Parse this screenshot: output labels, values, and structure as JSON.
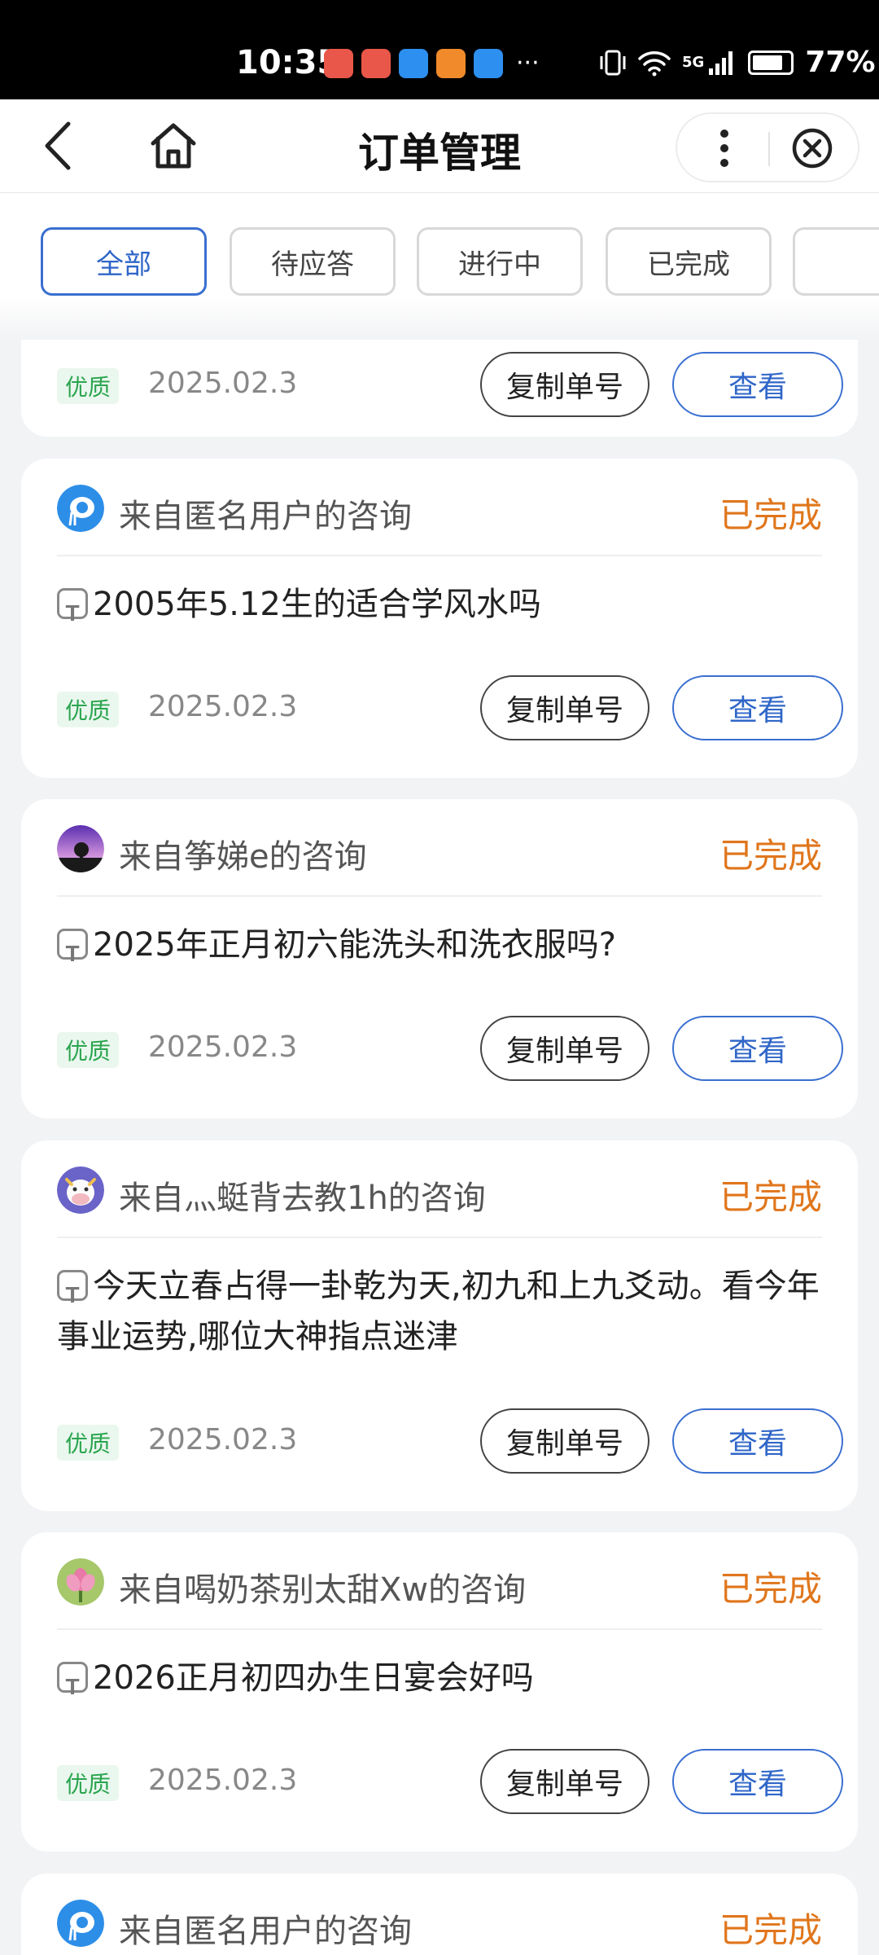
{
  "status_bar": {
    "time": "10:35",
    "more": "···",
    "network": "5G",
    "battery": "77%",
    "colors": {
      "app1": "#e9574a",
      "app2": "#e9574a",
      "app3": "#2d8ff0",
      "app4": "#f08a2a",
      "app5": "#2d8ff0"
    }
  },
  "nav": {
    "title": "订单管理",
    "back_icon": "chevron-left-icon",
    "home_icon": "home-icon",
    "more_icon": "more-vertical-icon",
    "close_icon": "close-circle-icon"
  },
  "tabs": [
    {
      "label": "全部",
      "active": true
    },
    {
      "label": "待应答",
      "active": false
    },
    {
      "label": "进行中",
      "active": false
    },
    {
      "label": "已完成",
      "active": false
    },
    {
      "label": "",
      "active": false
    }
  ],
  "orders": [
    {
      "from": "",
      "status": "",
      "question": "",
      "badge": "优质",
      "date": "2025.02.3",
      "copy_label": "复制单号",
      "view_label": "查看"
    },
    {
      "from": "来自匿名用户的咨询",
      "status": "已完成",
      "question": "2005年5.12生的适合学风水吗",
      "badge": "优质",
      "date": "2025.02.3",
      "copy_label": "复制单号",
      "view_label": "查看",
      "avatar": "anonymous"
    },
    {
      "from": "来自筝娣e的咨询",
      "status": "已完成",
      "question": "2025年正月初六能洗头和洗衣服吗?",
      "badge": "优质",
      "date": "2025.02.3",
      "copy_label": "复制单号",
      "view_label": "查看",
      "avatar": "tree"
    },
    {
      "from": "来自灬蜓背去教1h的咨询",
      "status": "已完成",
      "question": "今天立春占得一卦乾为天,初九和上九爻动。看今年事业运势,哪位大神指点迷津",
      "badge": "优质",
      "date": "2025.02.3",
      "copy_label": "复制单号",
      "view_label": "查看",
      "avatar": "cow"
    },
    {
      "from": "来自喝奶茶别太甜Xw的咨询",
      "status": "已完成",
      "question": "2026正月初四办生日宴会好吗",
      "badge": "优质",
      "date": "2025.02.3",
      "copy_label": "复制单号",
      "view_label": "查看",
      "avatar": "lotus"
    },
    {
      "from": "来自匿名用户的咨询",
      "status": "已完成",
      "question": "",
      "badge": "",
      "date": "",
      "copy_label": "",
      "view_label": "",
      "avatar": "anonymous"
    }
  ],
  "colors": {
    "accent": "#2f66c8",
    "status_done": "#e0761c",
    "badge_green": "#2aa54f"
  }
}
